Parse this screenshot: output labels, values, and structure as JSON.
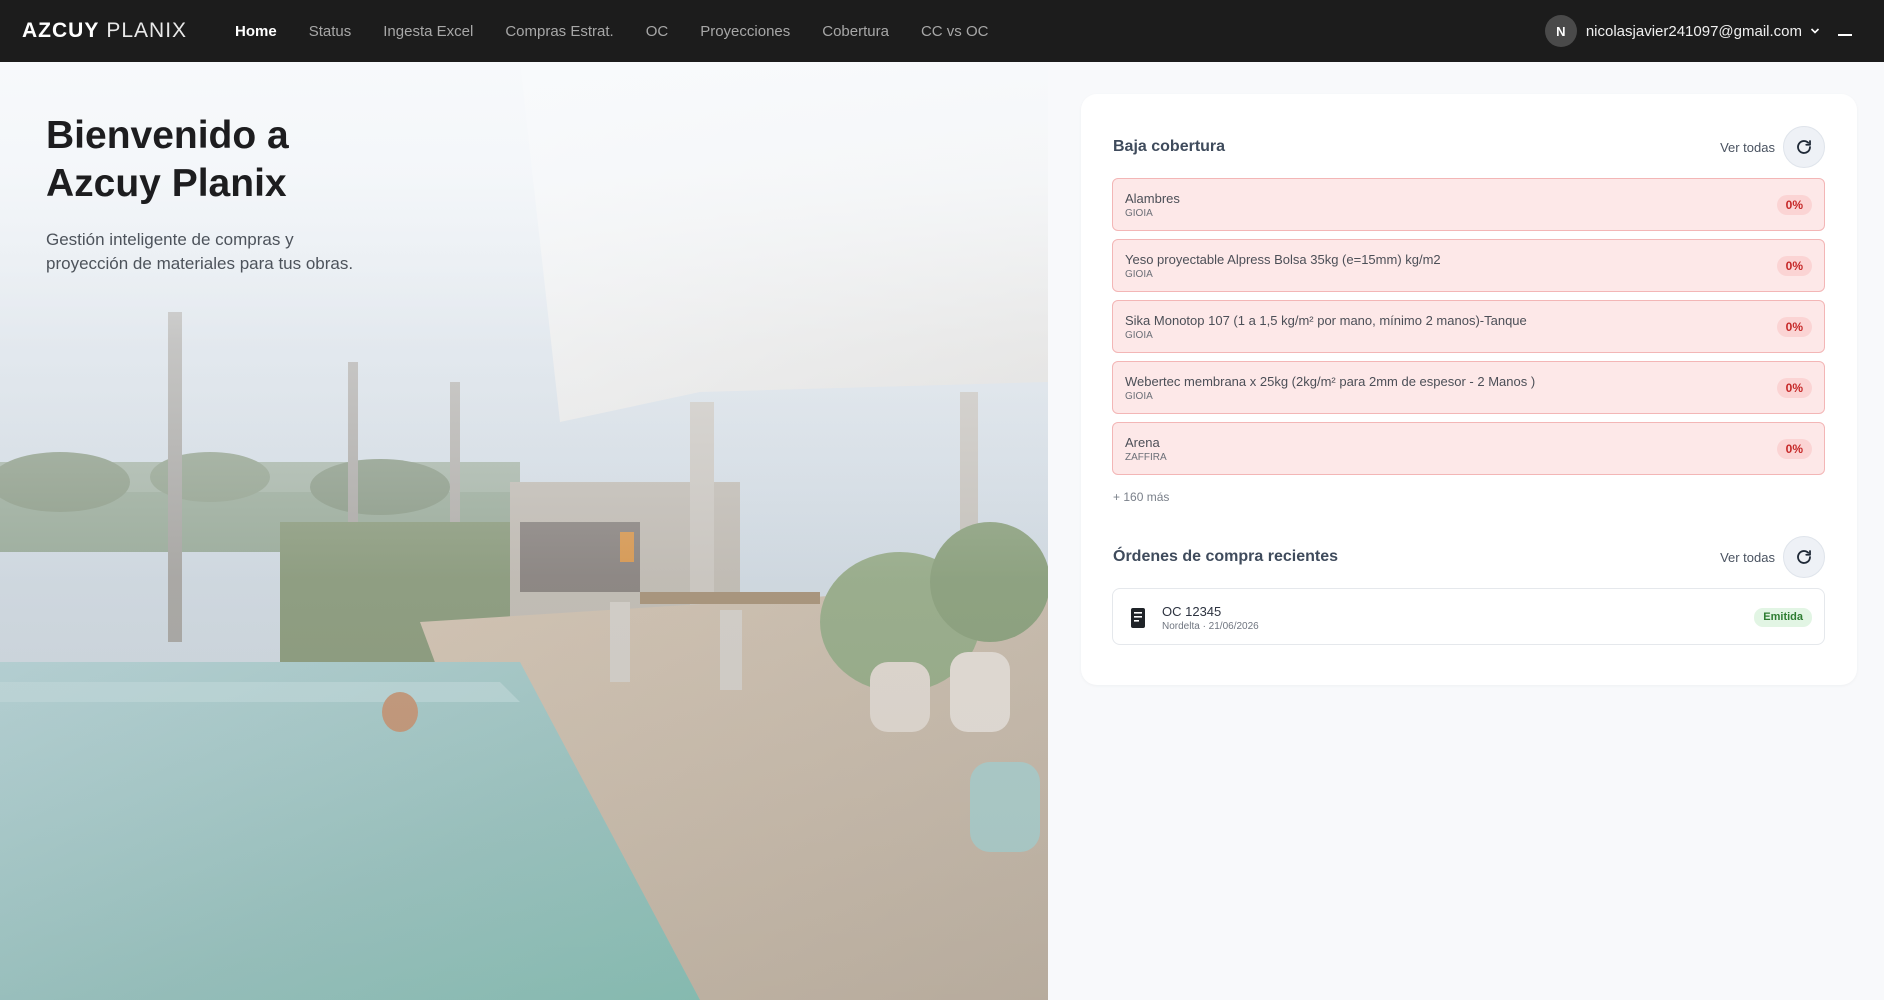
{
  "brand": {
    "part1": "AZCUY",
    "part2": "PLANIX"
  },
  "nav": {
    "items": [
      {
        "label": "Home",
        "active": true
      },
      {
        "label": "Status",
        "active": false
      },
      {
        "label": "Ingesta Excel",
        "active": false
      },
      {
        "label": "Compras Estrat.",
        "active": false
      },
      {
        "label": "OC",
        "active": false
      },
      {
        "label": "Proyecciones",
        "active": false
      },
      {
        "label": "Cobertura",
        "active": false
      },
      {
        "label": "CC vs OC",
        "active": false
      }
    ],
    "user": {
      "initial": "N",
      "email": "nicolasjavier241097@gmail.com"
    }
  },
  "hero": {
    "title_line1": "Bienvenido a",
    "title_line2": "Azcuy Planix",
    "subtitle": "Gestión inteligente de compras y proyección de materiales para tus obras."
  },
  "coverage": {
    "title": "Baja cobertura",
    "view_all": "Ver todas",
    "items": [
      {
        "name": "Alambres",
        "supplier": "GIOIA",
        "percent": "0%"
      },
      {
        "name": "Yeso proyectable Alpress Bolsa 35kg (e=15mm) kg/m2",
        "supplier": "GIOIA",
        "percent": "0%"
      },
      {
        "name": "Sika Monotop 107 (1 a 1,5 kg/m² por mano,  mínimo 2 manos)-Tanque",
        "supplier": "GIOIA",
        "percent": "0%"
      },
      {
        "name": "Webertec membrana x 25kg (2kg/m² para 2mm de espesor - 2 Manos )",
        "supplier": "GIOIA",
        "percent": "0%"
      },
      {
        "name": "Arena",
        "supplier": "ZAFFIRA",
        "percent": "0%"
      }
    ],
    "more": "+ 160 más"
  },
  "orders": {
    "title": "Órdenes de compra recientes",
    "view_all": "Ver todas",
    "items": [
      {
        "title": "OC 12345",
        "meta": "Nordelta · 21/06/2026",
        "status": "Emitida"
      }
    ]
  },
  "colors": {
    "navbar_bg": "#1c1c1c",
    "low_coverage_bg": "#fde8e8",
    "low_coverage_text": "#c62828",
    "status_emitida": "#2e7d32"
  },
  "icons": {
    "refresh": "refresh-icon",
    "document": "document-icon",
    "chevron": "chevron-down-icon",
    "menu": "menu-icon"
  }
}
